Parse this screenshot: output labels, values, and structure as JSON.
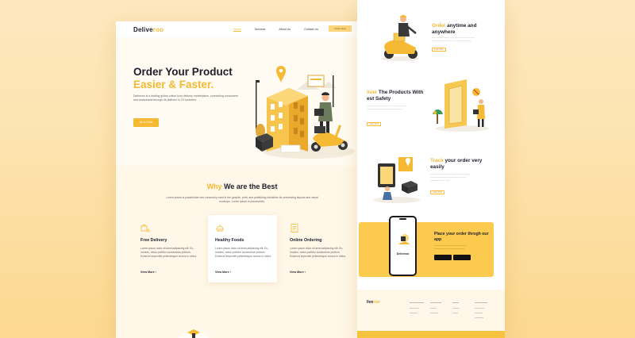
{
  "brand": {
    "logo_dark": "Delive",
    "logo_yellow": "roo"
  },
  "nav": {
    "items": [
      "Home",
      "Services",
      "About Us",
      "Contact Us"
    ],
    "cta": "Order Now"
  },
  "hero": {
    "title_line1": "Order Your Product",
    "title_line2": "Easier & Faster.",
    "paragraph": "Deliveroo is a leading global online food delivery marketplace, connecting consumers and restaurants through its platform in 24 countries.",
    "button": "Go to Order"
  },
  "why": {
    "title_yellow": "Why",
    "title_dark": "We are the Best",
    "subtitle": "Lorem ipsum is placeholder text commonly used in the graphic, print, and publishing industries for previewing layouts and visual mockups. Lorem ipsum is placeholder.",
    "cards": [
      {
        "title": "Free Delivery",
        "desc": "Lorem ipsum dolor sit amet,adipiscing elit. Eu, montes, netus porttitor consectetur pretium. Euismod imperdiet pellentesque cursus in netus.",
        "link": "View More",
        "icon": "delivery-bag-icon"
      },
      {
        "title": "Healthy Foods",
        "desc": "Lorem ipsum dolor sit amet,adipiscing elit. Eu, montes, netus porttitor consectetur pretium. Euismod imperdiet pellentesque cursus in netus.",
        "link": "View More",
        "icon": "food-tray-icon"
      },
      {
        "title": "Online Ordering",
        "desc": "Lorem ipsum dolor sit amet,adipiscing elit. Eu, montes, netus porttitor consectetur pretium. Euismod imperdiet pellentesque cursus in netus.",
        "link": "View More",
        "icon": "order-clipboard-icon"
      }
    ]
  },
  "side": {
    "sec1": {
      "title_yellow": "Order",
      "title_rest": " anytime and anywhere",
      "button": "Learn More"
    },
    "sec2": {
      "title_yellow": "liver",
      "title_rest": " The Products With",
      "title_line2": "est Safety",
      "button": "Learn More"
    },
    "sec3": {
      "title_yellow": "Track",
      "title_rest": " your order very",
      "title_line2": "easily",
      "button": "Learn More"
    },
    "promo": {
      "title": "Place your order throgh our app",
      "phone_logo": "Deliveroo"
    },
    "footer": {
      "logo_dark": "live",
      "logo_yellow": "roo"
    }
  },
  "colors": {
    "accent": "#f5b933",
    "background": "#fde8bf",
    "promo": "#fcca4e"
  }
}
